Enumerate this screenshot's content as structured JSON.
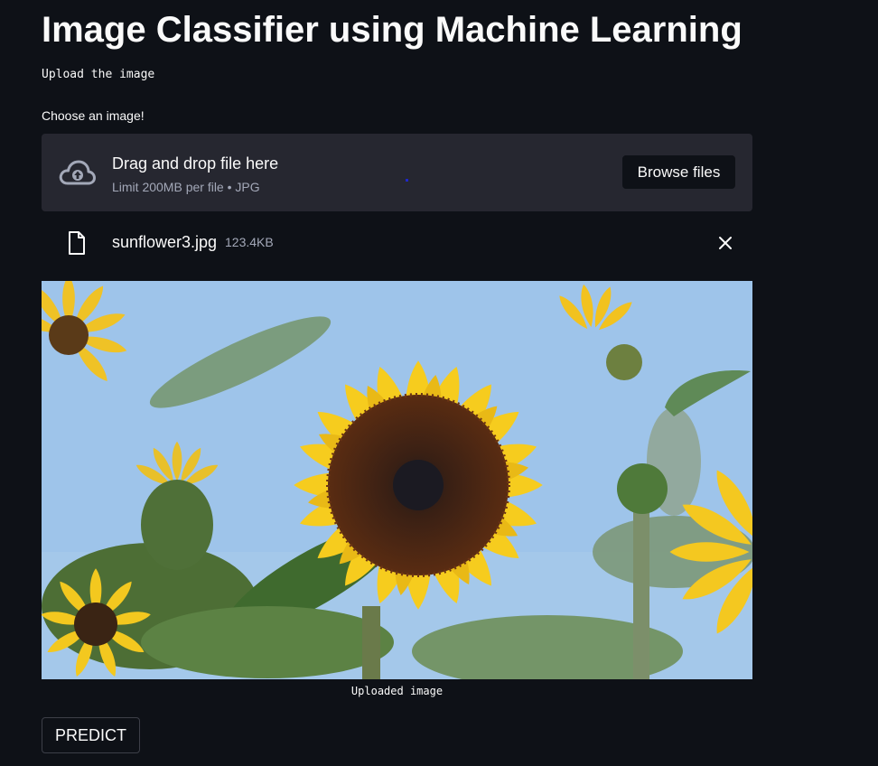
{
  "page": {
    "title": "Image Classifier using Machine Learning",
    "subtitle": "Upload the image"
  },
  "uploader": {
    "label": "Choose an image!",
    "drop_text": "Drag and drop file here",
    "limit_text": "Limit 200MB per file • JPG",
    "browse_label": "Browse files",
    "icon": "cloud-upload-icon"
  },
  "uploaded_file": {
    "name": "sunflower3.jpg",
    "size": "123.4KB",
    "icon": "file-icon",
    "remove_icon": "close-icon"
  },
  "image": {
    "caption": "Uploaded image",
    "sky_color": "#9ec4ea",
    "petal_color": "#f6cc1e",
    "center_color": "#4a2410",
    "leaf_color": "#5a7a3c"
  },
  "actions": {
    "predict_label": "PREDICT"
  },
  "colors": {
    "background": "#0e1117",
    "surface": "#262730",
    "text": "#fafafa",
    "muted": "#a3a8b8"
  }
}
